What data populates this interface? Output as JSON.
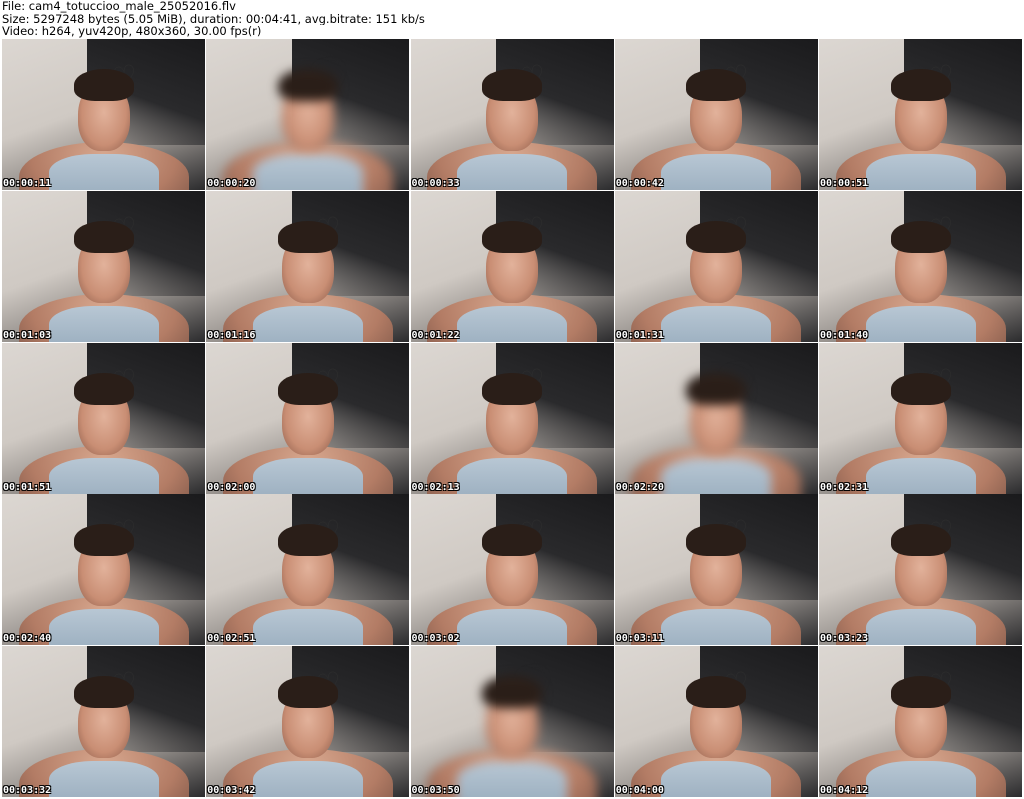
{
  "header": {
    "file_line": "File: cam4_totuccioo_male_25052016.flv",
    "size_line": "Size: 5297248 bytes (5.05 MiB), duration: 00:04:41, avg.bitrate: 151 kb/s",
    "video_line": "Video: h264, yuv420p, 480x360, 30.00 fps(r)"
  },
  "thumbnails": [
    {
      "time": "00:00:11",
      "blurred": false
    },
    {
      "time": "00:00:20",
      "blurred": true
    },
    {
      "time": "00:00:33",
      "blurred": false
    },
    {
      "time": "00:00:42",
      "blurred": false
    },
    {
      "time": "00:00:51",
      "blurred": false
    },
    {
      "time": "00:01:03",
      "blurred": false
    },
    {
      "time": "00:01:16",
      "blurred": false
    },
    {
      "time": "00:01:22",
      "blurred": false
    },
    {
      "time": "00:01:31",
      "blurred": false
    },
    {
      "time": "00:01:40",
      "blurred": false
    },
    {
      "time": "00:01:51",
      "blurred": false
    },
    {
      "time": "00:02:00",
      "blurred": false
    },
    {
      "time": "00:02:13",
      "blurred": false
    },
    {
      "time": "00:02:20",
      "blurred": true
    },
    {
      "time": "00:02:31",
      "blurred": false
    },
    {
      "time": "00:02:40",
      "blurred": false
    },
    {
      "time": "00:02:51",
      "blurred": false
    },
    {
      "time": "00:03:02",
      "blurred": false
    },
    {
      "time": "00:03:11",
      "blurred": false
    },
    {
      "time": "00:03:23",
      "blurred": false
    },
    {
      "time": "00:03:32",
      "blurred": false
    },
    {
      "time": "00:03:42",
      "blurred": false
    },
    {
      "time": "00:03:50",
      "blurred": true
    },
    {
      "time": "00:04:00",
      "blurred": false
    },
    {
      "time": "00:04:12",
      "blurred": false
    }
  ]
}
